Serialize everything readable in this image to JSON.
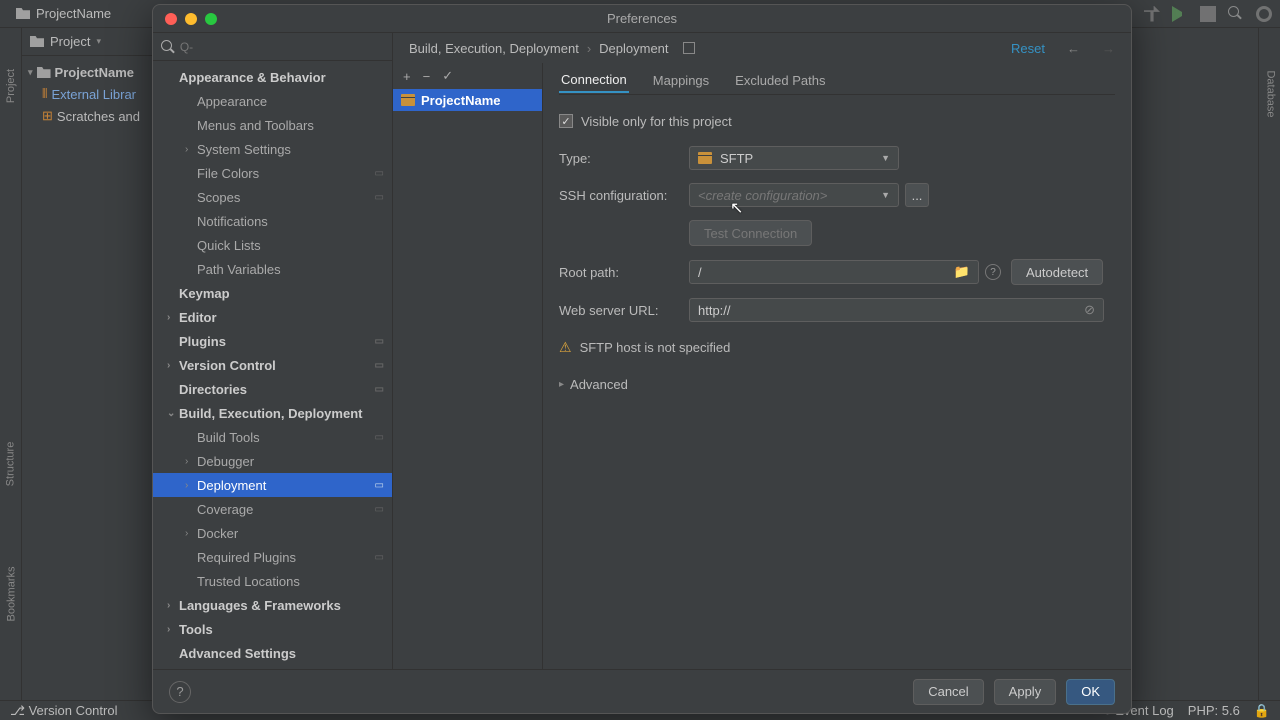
{
  "ide": {
    "project_name": "ProjectName",
    "project_view_label": "Project",
    "tree": {
      "root": "ProjectName",
      "ext_lib": "External Librar",
      "scratch": "Scratches and"
    },
    "left_rail": {
      "project": "Project",
      "structure": "Structure",
      "bookmarks": "Bookmarks"
    },
    "right_rail": {
      "database": "Database"
    },
    "bottom": {
      "vc": "Version Control",
      "event_log": "Event Log",
      "php": "PHP: 5.6"
    }
  },
  "dialog": {
    "title": "Preferences",
    "search_placeholder": "Q-",
    "breadcrumb": {
      "a": "Build, Execution, Deployment",
      "b": "Deployment"
    },
    "reset": "Reset",
    "sidebar": [
      {
        "label": "Appearance & Behavior",
        "bold": true
      },
      {
        "label": "Appearance",
        "child": true
      },
      {
        "label": "Menus and Toolbars",
        "child": true
      },
      {
        "label": "System Settings",
        "child": true,
        "chev": "›"
      },
      {
        "label": "File Colors",
        "child": true,
        "dots": true
      },
      {
        "label": "Scopes",
        "child": true,
        "dots": true
      },
      {
        "label": "Notifications",
        "child": true
      },
      {
        "label": "Quick Lists",
        "child": true
      },
      {
        "label": "Path Variables",
        "child": true
      },
      {
        "label": "Keymap",
        "bold": true
      },
      {
        "label": "Editor",
        "bold": true,
        "chev": "›"
      },
      {
        "label": "Plugins",
        "bold": true,
        "dots": true
      },
      {
        "label": "Version Control",
        "bold": true,
        "chev": "›",
        "dots": true
      },
      {
        "label": "Directories",
        "bold": true,
        "dots": true
      },
      {
        "label": "Build, Execution, Deployment",
        "bold": true,
        "chev": "⌄"
      },
      {
        "label": "Build Tools",
        "child": true,
        "dots": true
      },
      {
        "label": "Debugger",
        "child": true,
        "chev": "›"
      },
      {
        "label": "Deployment",
        "child": true,
        "chev": "›",
        "dots": true,
        "selected": true
      },
      {
        "label": "Coverage",
        "child": true,
        "dots": true
      },
      {
        "label": "Docker",
        "child": true,
        "chev": "›"
      },
      {
        "label": "Required Plugins",
        "child": true,
        "dots": true
      },
      {
        "label": "Trusted Locations",
        "child": true
      },
      {
        "label": "Languages & Frameworks",
        "bold": true,
        "chev": "›"
      },
      {
        "label": "Tools",
        "bold": true,
        "chev": "›"
      },
      {
        "label": "Advanced Settings",
        "bold": true
      }
    ],
    "deploy": {
      "server_name": "ProjectName",
      "tabs": {
        "connection": "Connection",
        "mappings": "Mappings",
        "excluded": "Excluded Paths"
      },
      "visible_label": "Visible only for this project",
      "type_label": "Type:",
      "type_value": "SFTP",
      "ssh_label": "SSH configuration:",
      "ssh_placeholder": "<create configuration>",
      "ssh_more": "...",
      "test_btn": "Test Connection",
      "root_label": "Root path:",
      "root_value": "/",
      "autodetect": "Autodetect",
      "url_label": "Web server URL:",
      "url_value": "http://",
      "warning": "SFTP host is not specified",
      "advanced": "Advanced",
      "tool_add": "+",
      "tool_rm": "−",
      "tool_ok": "✓"
    },
    "buttons": {
      "cancel": "Cancel",
      "apply": "Apply",
      "ok": "OK"
    }
  }
}
